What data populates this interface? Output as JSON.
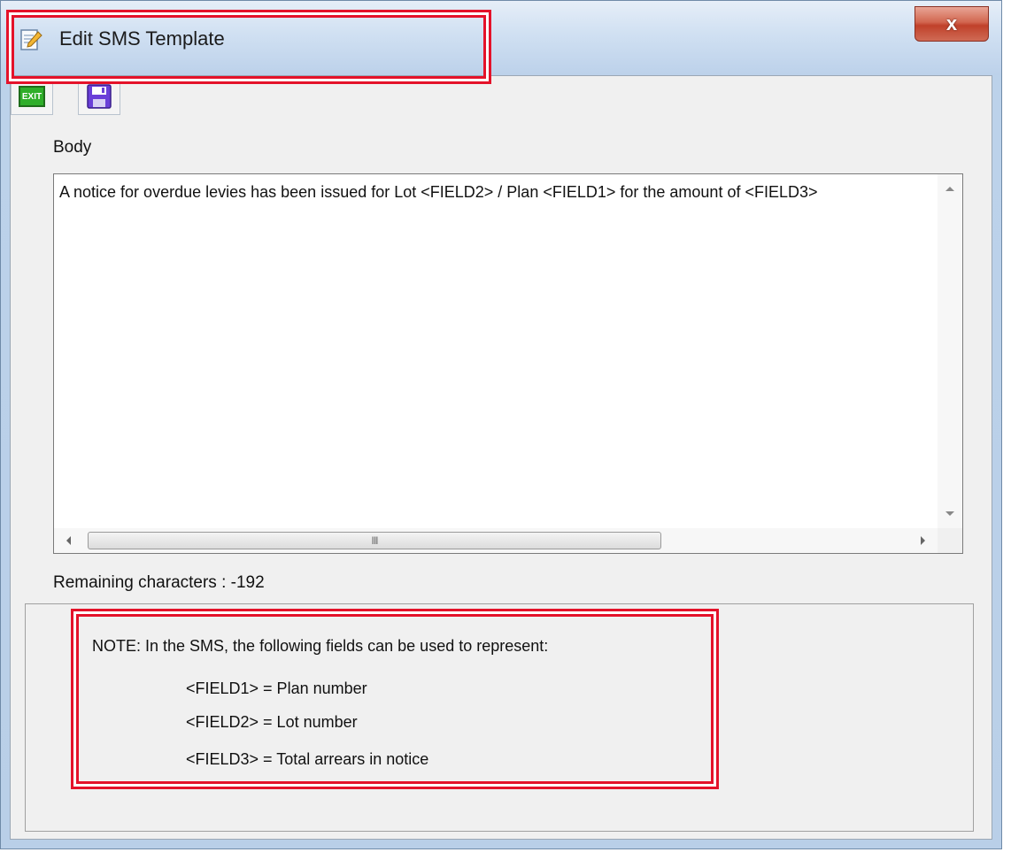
{
  "window": {
    "title": "Edit SMS Template",
    "close_label": "x"
  },
  "toolbar": {
    "exit_label": "EXIT",
    "exit_icon": "exit-icon",
    "save_icon": "floppy-disk-icon"
  },
  "form": {
    "body_label": "Body",
    "body_text": "A notice for overdue levies has been issued for Lot <FIELD2> / Plan <FIELD1> for the amount of <FIELD3>",
    "hscroll_grip": "III",
    "remaining_label": "Remaining characters : -192"
  },
  "note": {
    "heading": "NOTE: In the SMS, the following fields can be used to represent:",
    "fields": [
      "<FIELD1> = Plan number",
      "<FIELD2> = Lot number",
      "<FIELD3> = Total arrears in notice"
    ]
  },
  "colors": {
    "highlight": "#e4122a",
    "close_button": "#c0412a"
  }
}
